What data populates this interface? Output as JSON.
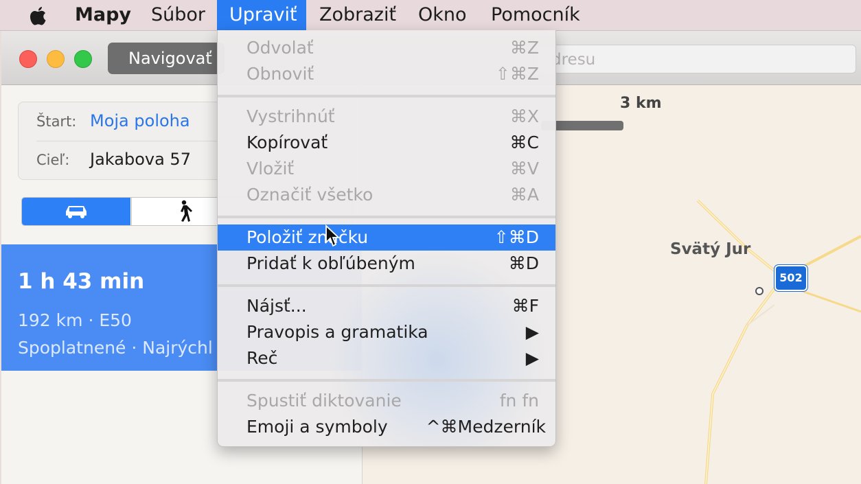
{
  "menubar": {
    "apple_icon": "apple-icon",
    "items": [
      {
        "label": "Mapy"
      },
      {
        "label": "Súbor"
      },
      {
        "label": "Upraviť"
      },
      {
        "label": "Zobraziť"
      },
      {
        "label": "Okno"
      },
      {
        "label": "Pomocník"
      }
    ]
  },
  "window": {
    "nav_button": "Navigovať",
    "search_partial": "dresu"
  },
  "sidebar": {
    "start_label": "Štart:",
    "start_value": "Moja poloha",
    "dest_label": "Cieľ:",
    "dest_value": "Jakabova 57",
    "modes": [
      "car-icon",
      "walk-icon"
    ],
    "result": {
      "time": "1 h 43 min",
      "distance": "192 km · E50",
      "details": "Spoplatnené · Najrýchl"
    }
  },
  "map": {
    "scale_label": "3 km",
    "place_label": "Svätý Jur",
    "road_shield": "502"
  },
  "edit_menu": {
    "items": [
      {
        "label": "Odvolať",
        "shortcut": "⌘Z",
        "enabled": false
      },
      {
        "label": "Obnoviť",
        "shortcut": "⇧⌘Z",
        "enabled": false
      },
      {
        "label": "Vystrihnúť",
        "shortcut": "⌘X",
        "enabled": false
      },
      {
        "label": "Kopírovať",
        "shortcut": "⌘C",
        "enabled": true
      },
      {
        "label": "Vložiť",
        "shortcut": "⌘V",
        "enabled": false
      },
      {
        "label": "Označiť všetko",
        "shortcut": "⌘A",
        "enabled": false
      },
      {
        "label": "Položiť značku",
        "shortcut": "⇧⌘D",
        "enabled": true,
        "highlighted": true
      },
      {
        "label": "Pridať k obľúbeným",
        "shortcut": "⌘D",
        "enabled": true
      },
      {
        "label": "Nájsť...",
        "shortcut": "⌘F",
        "enabled": true
      },
      {
        "label": "Pravopis a gramatika",
        "shortcut": "▶",
        "enabled": true
      },
      {
        "label": "Reč",
        "shortcut": "▶",
        "enabled": true
      },
      {
        "label": "Spustiť diktovanie",
        "shortcut": "fn fn",
        "enabled": false
      },
      {
        "label": "Emoji a symboly",
        "shortcut": "^⌘Medzerník",
        "enabled": true
      }
    ]
  },
  "colors": {
    "accent": "#2f80f4",
    "menubar_active": "#2a7cf2",
    "route_result_bg": "#4a8cf3",
    "road_shield": "#1a6bd8"
  }
}
